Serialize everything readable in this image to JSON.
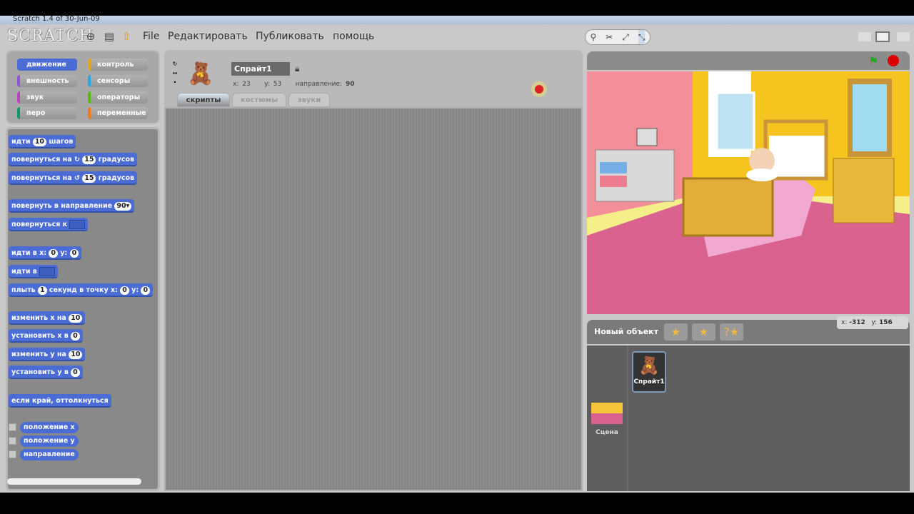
{
  "window": {
    "title": "Scratch 1.4 of 30-Jun-09"
  },
  "logo": "SCRATCH",
  "menu": [
    "File",
    "Редактировать",
    "Публиковать",
    "помощь"
  ],
  "categories": [
    {
      "label": "движение",
      "color": "#4a6cd4"
    },
    {
      "label": "контроль",
      "color": "#e1a91a"
    },
    {
      "label": "внешность",
      "color": "#8a55d7"
    },
    {
      "label": "сенсоры",
      "color": "#2ca5e2"
    },
    {
      "label": "звук",
      "color": "#bb42c3"
    },
    {
      "label": "операторы",
      "color": "#5cb712"
    },
    {
      "label": "перо",
      "color": "#0e9a6c"
    },
    {
      "label": "переменные",
      "color": "#ee7d16"
    }
  ],
  "blocks": {
    "move": [
      "идти",
      "10",
      "шагов"
    ],
    "turn_cw": [
      "повернуться на",
      "15",
      "градусов"
    ],
    "turn_ccw": [
      "повернуться на",
      "15",
      "градусов"
    ],
    "point_dir": [
      "повернуть в направление",
      "90▾"
    ],
    "point_to": [
      "повернуться к"
    ],
    "goto_xy": [
      "идти в x:",
      "0",
      "y:",
      "0"
    ],
    "goto": [
      "идти в"
    ],
    "glide": [
      "плыть",
      "1",
      "секунд в точку x:",
      "0",
      "y:",
      "0"
    ],
    "change_x": [
      "изменить x на",
      "10"
    ],
    "set_x": [
      "установить x в",
      "0"
    ],
    "change_y": [
      "изменить y на",
      "10"
    ],
    "set_y": [
      "установить y в",
      "0"
    ],
    "bounce": "если край, оттолкнуться",
    "reporters": [
      "положение x",
      "положение y",
      "направление"
    ]
  },
  "sprite": {
    "name": "Спрайт1",
    "x_label": "x:",
    "x": "23",
    "y_label": "y:",
    "y": "53",
    "dir_label": "направление:",
    "dir": "90"
  },
  "tabs": [
    "скрипты",
    "костюмы",
    "звуки"
  ],
  "active_tab": "скрипты",
  "stage": {
    "mouse_x_label": "x:",
    "mouse_x": "-312",
    "mouse_y_label": "y:",
    "mouse_y": "156"
  },
  "new_sprite": {
    "label": "Новый объект"
  },
  "sprites": [
    {
      "name": "Спрайт1"
    }
  ],
  "stage_thumb": {
    "name": "Сцена"
  }
}
